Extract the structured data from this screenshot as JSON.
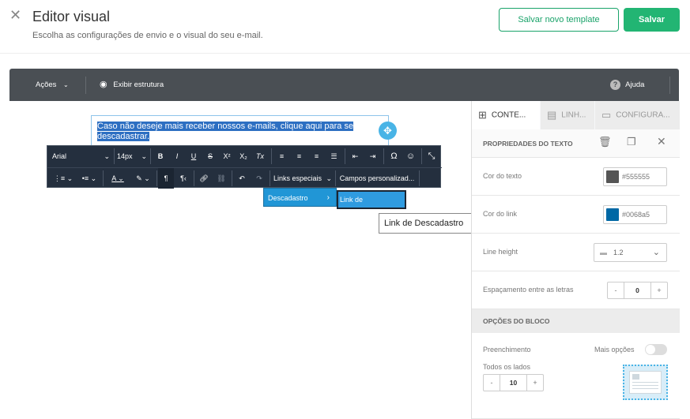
{
  "header": {
    "title": "Editor visual",
    "subtitle": "Escolha as configurações de envio e o visual do seu e-mail.",
    "save_template_label": "Salvar novo template",
    "save_label": "Salvar"
  },
  "topbar": {
    "actions_label": "Ações",
    "structure_label": "Exibir estrutura",
    "help_label": "Ajuda"
  },
  "canvas": {
    "selected_text": "Caso não deseje mais receber nossos e-mails, clique aqui para se descadastrar."
  },
  "rte": {
    "font": "Arial",
    "size": "14px",
    "bold": "B",
    "italic": "I",
    "underline": "U",
    "strike": "S",
    "superscript": "X²",
    "subscript": "X₂",
    "clear": "Tx",
    "omega": "Ω",
    "special_links": "Links especiais",
    "custom_fields": "Campos personalizad..."
  },
  "menu": {
    "item": "Descadastro",
    "submenu_item": "Link de Descadastro",
    "tooltip": "Link de Descadastro"
  },
  "panel": {
    "tabs": [
      {
        "label": "CONTE..."
      },
      {
        "label": "LINH..."
      },
      {
        "label": "CONFIGURA..."
      }
    ],
    "text_props_title": "PROPRIEDADES DO TEXTO",
    "text_color_label": "Cor do texto",
    "text_color_value": "#555555",
    "link_color_label": "Cor do link",
    "link_color_value": "#0068a5",
    "line_height_label": "Line height",
    "line_height_value": "1.2",
    "letter_spacing_label": "Espaçamento entre as letras",
    "letter_spacing_value": "0",
    "block_options_title": "OPÇÕES DO BLOCO",
    "padding_label": "Preenchimento",
    "more_options_label": "Mais opções",
    "all_sides_label": "Todos os lados",
    "padding_value": "10"
  },
  "colors": {
    "accent_green": "#22b573",
    "text_swatch": "#555555",
    "link_swatch": "#0068a5"
  }
}
